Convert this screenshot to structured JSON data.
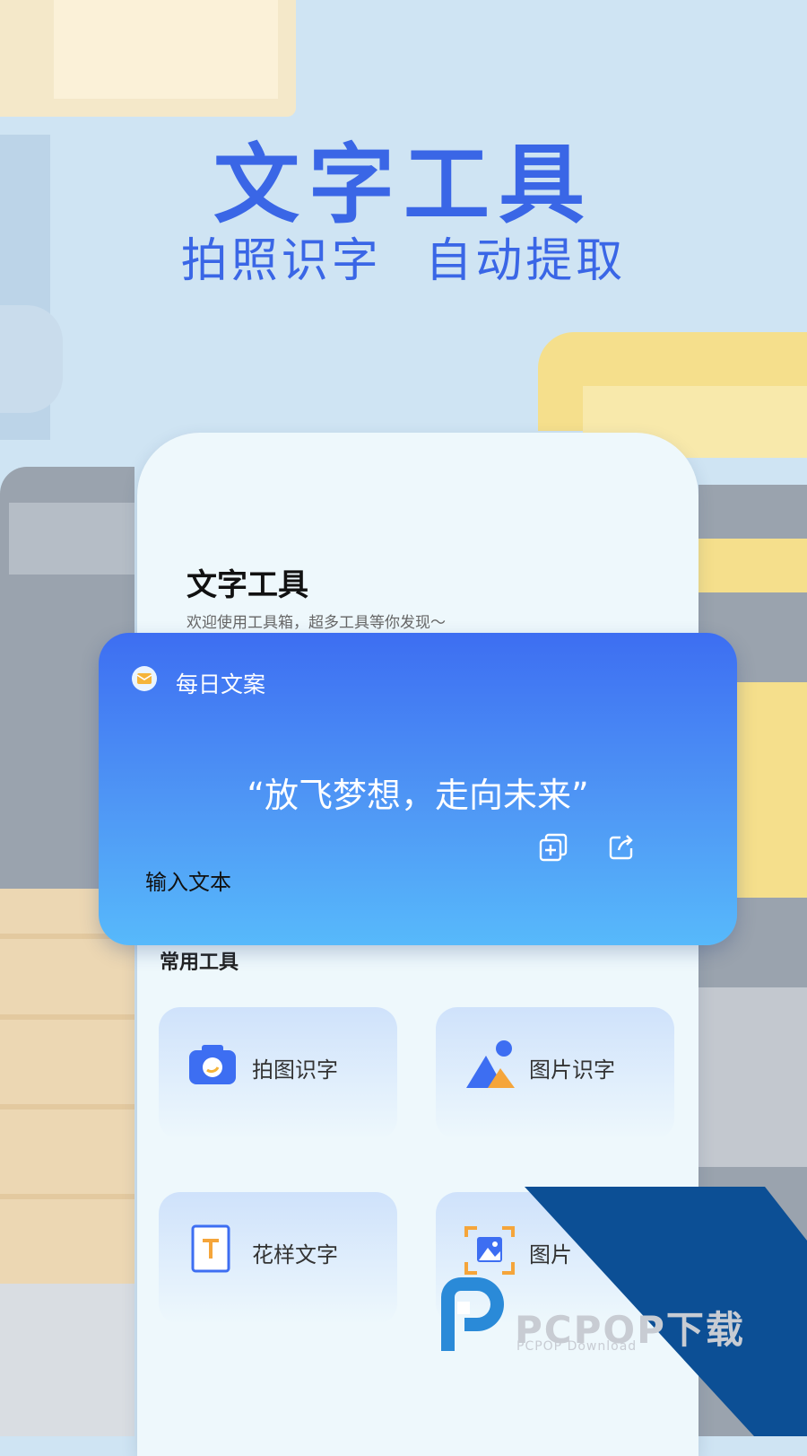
{
  "hero": {
    "title": "文字工具",
    "subtitle": "拍照识字  自动提取"
  },
  "app": {
    "title": "文字工具",
    "subtitle": "欢迎使用工具箱，超多工具等你发现～"
  },
  "daily_card": {
    "title": "每日文案",
    "quote": "“放飞梦想，走向未来”",
    "input_label": "输入文本",
    "icons": [
      "copy-add-icon",
      "share-icon"
    ]
  },
  "section": {
    "title": "常用工具"
  },
  "tools": [
    {
      "label": "拍图识字",
      "icon": "camera-icon"
    },
    {
      "label": "图片识字",
      "icon": "image-mountain-icon"
    },
    {
      "label": "花样文字",
      "icon": "text-t-icon"
    },
    {
      "label": "图片",
      "icon": "image-scan-icon"
    }
  ],
  "watermark": {
    "brand": "PCPOP下载",
    "tagline": "PCPOP Download"
  },
  "colors": {
    "accent": "#3a66e6",
    "card_top": "#3d6ef2",
    "card_bottom": "#57b9fb",
    "watermark_blue": "#0c4f95"
  }
}
